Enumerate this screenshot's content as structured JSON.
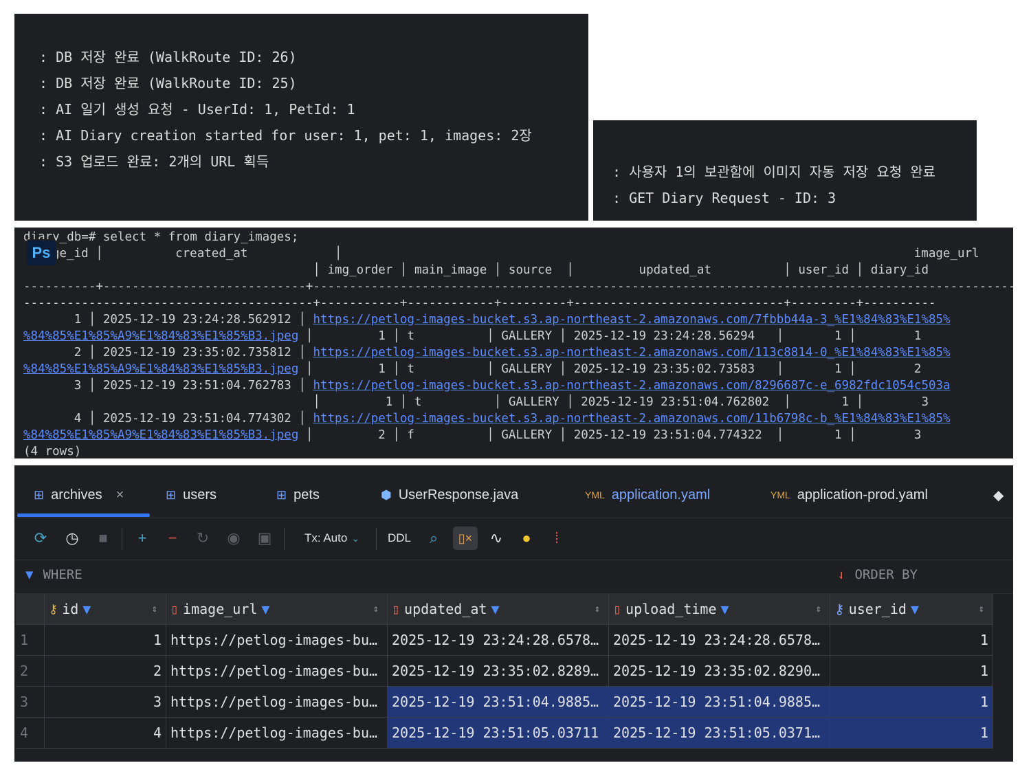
{
  "log1": {
    "lines": [
      ": DB 저장 완료 (WalkRoute ID: 26)",
      ": DB 저장 완료 (WalkRoute ID: 25)",
      ": AI 일기 생성 요청 - UserId: 1, PetId: 1",
      ": AI Diary creation started for user: 1, pet: 1, images: 2장",
      ": S3 업로드 완료: 2개의 URL 획득"
    ]
  },
  "log2": {
    "lines": [
      ": 사용자 1의 보관함에 이미지 자동 저장 요청 완료",
      ": GET Diary Request - ID: 3"
    ]
  },
  "psql": {
    "badge": "Ps",
    "prompt": "diary_db=# select * from diary_images;",
    "header1": "ge_id │          created_at            │                                                                               image_url",
    "header2": "                                        │ img_order │ main_image │ source  │         updated_at          │ user_id │ diary_id",
    "divider1": "----------+----------------------------+--------------------------------------------------------------------------------------------------------------",
    "divider2": "----------------------------------------+-----------+------------+---------+-----------------------------+---------+----------",
    "rows": [
      {
        "pre": "       1 │ 2025-12-19 23:24:28.562912 │ ",
        "url": "https://petlog-images-bucket.s3.ap-northeast-2.amazonaws.com/7fbbb44a-3_%E1%84%83%E1%85%",
        "url2": "%84%85%E1%85%A9%E1%84%83%E1%85%B3.jpeg",
        "tail": " │         1 │ t          │ GALLERY │ 2025-12-19 23:24:28.56294   │       1 │        1"
      },
      {
        "pre": "       2 │ 2025-12-19 23:35:02.735812 │ ",
        "url": "https://petlog-images-bucket.s3.ap-northeast-2.amazonaws.com/113c8814-0_%E1%84%83%E1%85%",
        "url2": "%84%85%E1%85%A9%E1%84%83%E1%85%B3.jpeg",
        "tail": " │         1 │ t          │ GALLERY │ 2025-12-19 23:35:02.73583   │       1 │        2"
      },
      {
        "pre": "       3 │ 2025-12-19 23:51:04.762783 │ ",
        "url": "https://petlog-images-bucket.s3.ap-northeast-2.amazonaws.com/8296687c-e_6982fdc1054c503a",
        "url2": "",
        "tail": "                                        │         1 │ t          │ GALLERY │ 2025-12-19 23:51:04.762802  │       1 │        3"
      },
      {
        "pre": "       4 │ 2025-12-19 23:51:04.774302 │ ",
        "url": "https://petlog-images-bucket.s3.ap-northeast-2.amazonaws.com/11b6798c-b_%E1%84%83%E1%85%",
        "url2": "%84%85%E1%85%A9%E1%84%83%E1%85%B3.jpeg",
        "tail": " │         2 │ f          │ GALLERY │ 2025-12-19 23:51:04.774322  │       1 │        3"
      }
    ],
    "footer": "(4 rows)"
  },
  "ide": {
    "tabs": [
      "archives",
      "users",
      "pets",
      "UserResponse.java",
      "application.yaml",
      "application-prod.yaml"
    ],
    "tab_close": "×",
    "toolbar": {
      "tx": "Tx: Auto",
      "ddl": "DDL"
    },
    "filter": {
      "where": "WHERE",
      "order_by": "ORDER BY"
    },
    "columns": [
      "id",
      "image_url",
      "updated_at",
      "upload_time",
      "user_id"
    ],
    "rows": [
      {
        "n": "1",
        "id": "1",
        "image_url": "https://petlog-images-bu…",
        "updated_at": "2025-12-19 23:24:28.6578…",
        "upload_time": "2025-12-19 23:24:28.6578…",
        "user_id": "1"
      },
      {
        "n": "2",
        "id": "2",
        "image_url": "https://petlog-images-bu…",
        "updated_at": "2025-12-19 23:35:02.8289…",
        "upload_time": "2025-12-19 23:35:02.8290…",
        "user_id": "1"
      },
      {
        "n": "3",
        "id": "3",
        "image_url": "https://petlog-images-bu…",
        "updated_at": "2025-12-19 23:51:04.9885…",
        "upload_time": "2025-12-19 23:51:04.9885…",
        "user_id": "1"
      },
      {
        "n": "4",
        "id": "4",
        "image_url": "https://petlog-images-bu…",
        "updated_at": "2025-12-19 23:51:05.03711",
        "upload_time": "2025-12-19 23:51:05.0371…",
        "user_id": "1"
      }
    ]
  }
}
